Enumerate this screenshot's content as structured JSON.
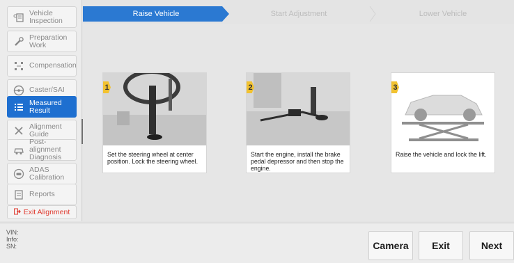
{
  "sidebar": {
    "items": [
      {
        "label": "Vehicle Inspection",
        "icon": "vehicle-inspection-icon"
      },
      {
        "label": "Preparation Work",
        "icon": "wrench-icon"
      },
      {
        "label": "Compensation",
        "icon": "compensation-icon"
      },
      {
        "label": "Caster/SAI",
        "icon": "steering-wheel-icon"
      },
      {
        "label": "Measured Result",
        "icon": "list-icon",
        "active": true
      },
      {
        "label": "Alignment Guide",
        "icon": "tools-icon"
      },
      {
        "label": "Post-alignment Diagnosis",
        "icon": "car-icon"
      },
      {
        "label": "ADAS Calibration",
        "icon": "adas-icon"
      },
      {
        "label": "Reports",
        "icon": "report-icon"
      }
    ],
    "exit_label": "Exit Alignment"
  },
  "steps": [
    "Raise Vehicle",
    "Start Adjustment",
    "Lower Vehicle"
  ],
  "cards": [
    {
      "number": "1",
      "caption": "Set the steering wheel at center position. Lock the steering wheel."
    },
    {
      "number": "2",
      "caption": "Start the engine, install the brake pedal depressor and then stop the engine."
    },
    {
      "number": "3",
      "caption": "Raise the vehicle and lock the lift."
    }
  ],
  "info": {
    "vin": "VIN:",
    "info": "Info:",
    "sn": "SN:"
  },
  "buttons": {
    "camera": "Camera",
    "exit": "Exit",
    "next": "Next"
  },
  "colors": {
    "accent": "#1e6fd0",
    "exit_red": "#e03a2f",
    "step_badge": "#f2c230"
  }
}
